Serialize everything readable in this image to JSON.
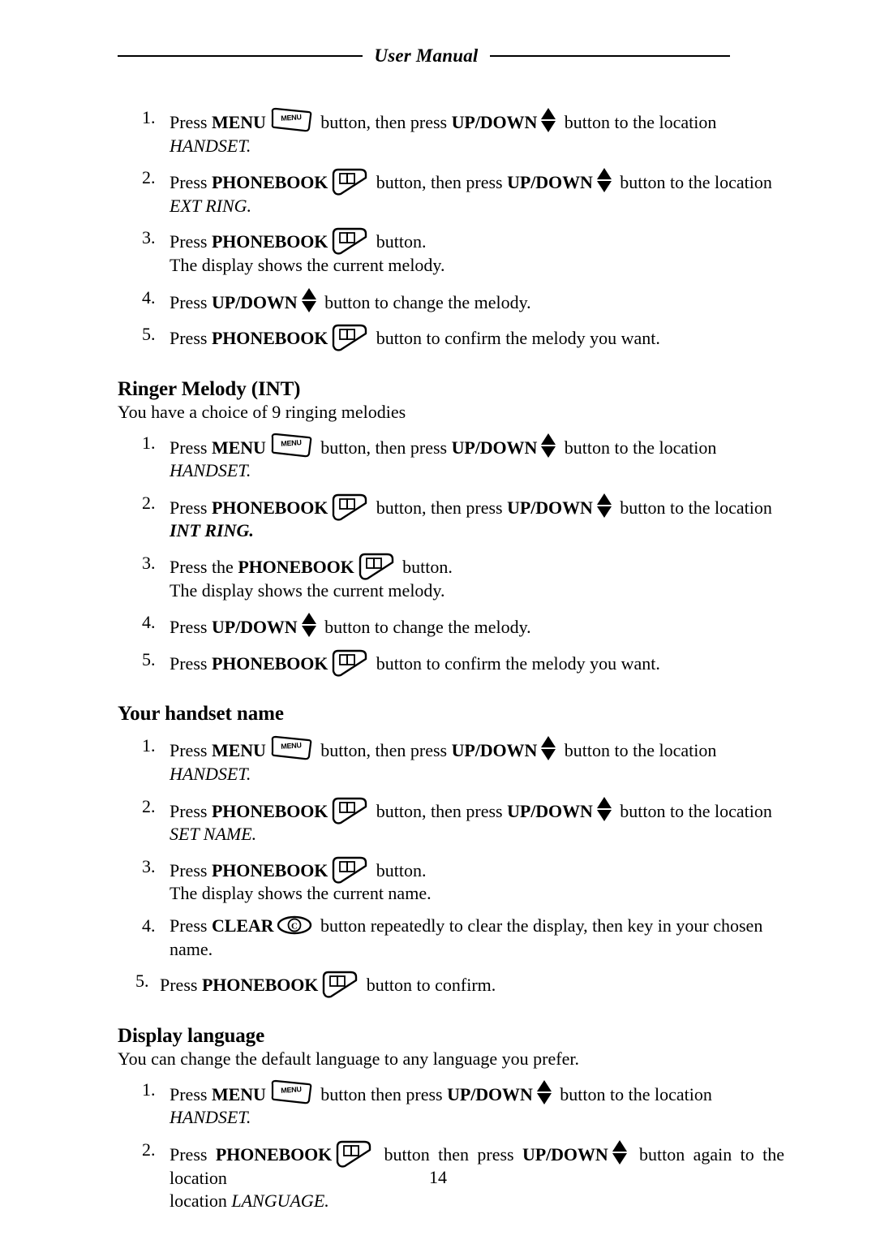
{
  "header": {
    "title": "User Manual"
  },
  "footer": {
    "page_number": "14"
  },
  "labels": {
    "press": "Press",
    "press_the": "Press the",
    "menu": "MENU",
    "phonebook": "PHONEBOOK",
    "updown": "UP/DOWN",
    "clear": "CLEAR",
    "btn_then_press_comma": "button, then press",
    "btn_then_press": "button then press",
    "to_the_location": "button to the location",
    "to_the_location_again": "button again to the location",
    "button_period": "button.",
    "loc_handset": "HANDSET.",
    "loc_ext_ring": "EXT RING.",
    "loc_int_ring": "INT RING.",
    "loc_set_name": "SET NAME.",
    "loc_language": "LANGUAGE.",
    "location_word": "location",
    "display_shows_melody": "The display shows the current melody.",
    "display_shows_name": "The display shows the current name.",
    "change_melody": "button to change the melody.",
    "confirm_melody": "button to confirm the melody you want.",
    "confirm": "button to confirm.",
    "clear_repeatedly": "button repeatedly to clear the display, then key in your chosen",
    "name_word": "name."
  },
  "icons": {
    "menu_label": "MENU",
    "clear_label": "C"
  },
  "sections": [
    {
      "id": "ext-ring-steps",
      "heading": null,
      "intro": null,
      "numbers": [
        "1.",
        "2.",
        "3.",
        "4.",
        "5."
      ]
    },
    {
      "id": "ringer-melody-int",
      "heading": "Ringer Melody (INT)",
      "intro": "You have a choice of 9 ringing melodies",
      "numbers": [
        "1.",
        "2.",
        "3.",
        "4.",
        "5."
      ]
    },
    {
      "id": "your-handset-name",
      "heading": "Your handset name",
      "intro": null,
      "numbers": [
        "1.",
        "2.",
        "3.",
        "4.",
        "5."
      ]
    },
    {
      "id": "display-language",
      "heading": "Display language",
      "intro": "You can change the default language to any language you prefer.",
      "numbers": [
        "1.",
        "2."
      ]
    }
  ]
}
